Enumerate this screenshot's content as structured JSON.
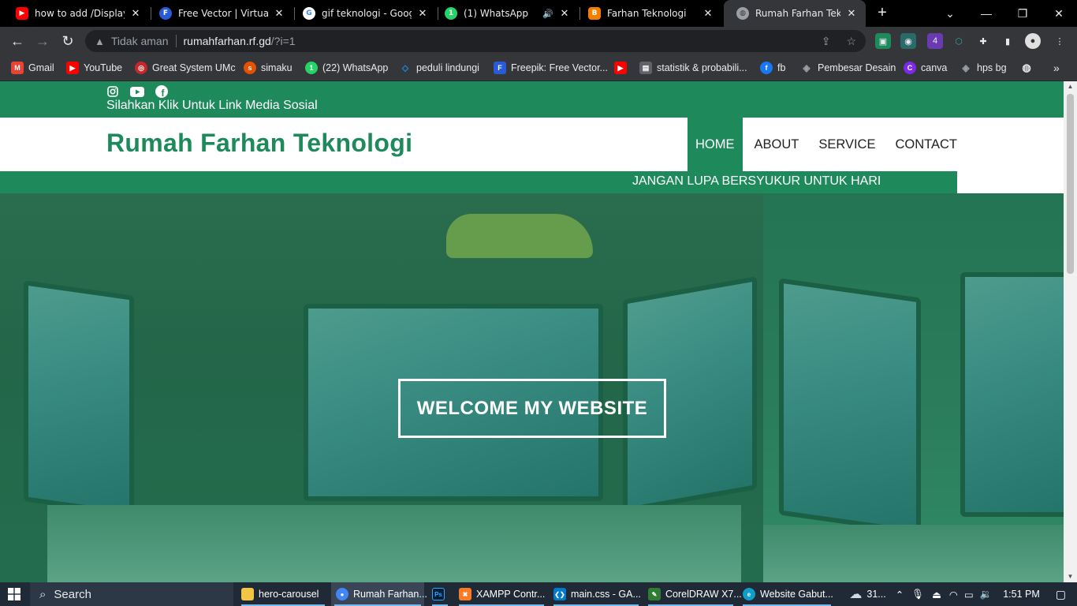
{
  "browser": {
    "tabs": [
      {
        "title": "how to add /Display G",
        "favicon": "youtube-icon",
        "color": "#ff0000"
      },
      {
        "title": "Free Vector | Virtual re",
        "favicon": "freepik-icon",
        "color": "#2a5bd7"
      },
      {
        "title": "gif teknologi - Google",
        "favicon": "google-icon",
        "color": "#4285f4"
      },
      {
        "title": "(1) WhatsApp",
        "favicon": "whatsapp-icon",
        "color": "#25d366"
      },
      {
        "title": "Farhan Teknologi",
        "favicon": "blogger-icon",
        "color": "#f57d00"
      },
      {
        "title": "Rumah Farhan Teknolo",
        "favicon": "globe-icon",
        "color": "#9aa0a6"
      }
    ],
    "security_label": "Tidak aman",
    "url_host": "rumahfarhan.rf.gd",
    "url_path": "/?i=1"
  },
  "bookmarks": [
    {
      "label": "Gmail",
      "icon": "gmail-icon",
      "color": "#ea4335"
    },
    {
      "label": "YouTube",
      "icon": "youtube-icon",
      "color": "#ff0000"
    },
    {
      "label": "Great System UMc",
      "icon": "umc-icon",
      "color": "#c62828"
    },
    {
      "label": "simaku",
      "icon": "simaku-icon",
      "color": "#e65100"
    },
    {
      "label": "(22) WhatsApp",
      "icon": "whatsapp-icon",
      "color": "#25d366"
    },
    {
      "label": "peduli lindungi",
      "icon": "pedulilindungi-icon",
      "color": "#1e88e5"
    },
    {
      "label": "Freepik: Free Vector...",
      "icon": "freepik-icon",
      "color": "#2a5bd7"
    },
    {
      "label": "",
      "icon": "youtube-icon",
      "color": "#ff0000"
    },
    {
      "label": "statistik & probabili...",
      "icon": "document-icon",
      "color": "#5f6368"
    },
    {
      "label": "fb",
      "icon": "facebook-icon",
      "color": "#1877f2"
    },
    {
      "label": "Pembesar Desain",
      "icon": "layers-icon",
      "color": "#9aa0a6"
    },
    {
      "label": "canva",
      "icon": "canva-icon",
      "color": "#7d2ae8"
    },
    {
      "label": "hps bg",
      "icon": "layers-icon",
      "color": "#9aa0a6"
    }
  ],
  "site": {
    "social_caption": "Silahkan Klik Untuk Link Media Sosial",
    "brand": "Rumah Farhan Teknologi",
    "menu": [
      "HOME",
      "ABOUT",
      "SERVICE",
      "CONTACT"
    ],
    "marquee": "JANGAN LUPA BERSYUKUR UNTUK HARI",
    "hero_title": "WELCOME MY WEBSITE",
    "accent_color": "#1e8a5c"
  },
  "taskbar": {
    "search_label": "Search",
    "items": [
      {
        "label": "hero-carousel",
        "icon": "folder-icon",
        "color": "#f4c542"
      },
      {
        "label": "Rumah Farhan...",
        "icon": "chrome-icon",
        "color": "#4285f4"
      },
      {
        "label": "Ps",
        "icon": "photoshop-icon",
        "color": "#001e36"
      },
      {
        "label": "XAMPP Contr...",
        "icon": "xampp-icon",
        "color": "#fb7a24"
      },
      {
        "label": "main.css - GA...",
        "icon": "vscode-icon",
        "color": "#007acc"
      },
      {
        "label": "CorelDRAW X7...",
        "icon": "coreldraw-icon",
        "color": "#2e7d32"
      },
      {
        "label": "Website Gabut...",
        "icon": "edge-icon",
        "color": "#0f9ec7"
      }
    ],
    "weather": "31...",
    "time": "1:51 PM"
  }
}
